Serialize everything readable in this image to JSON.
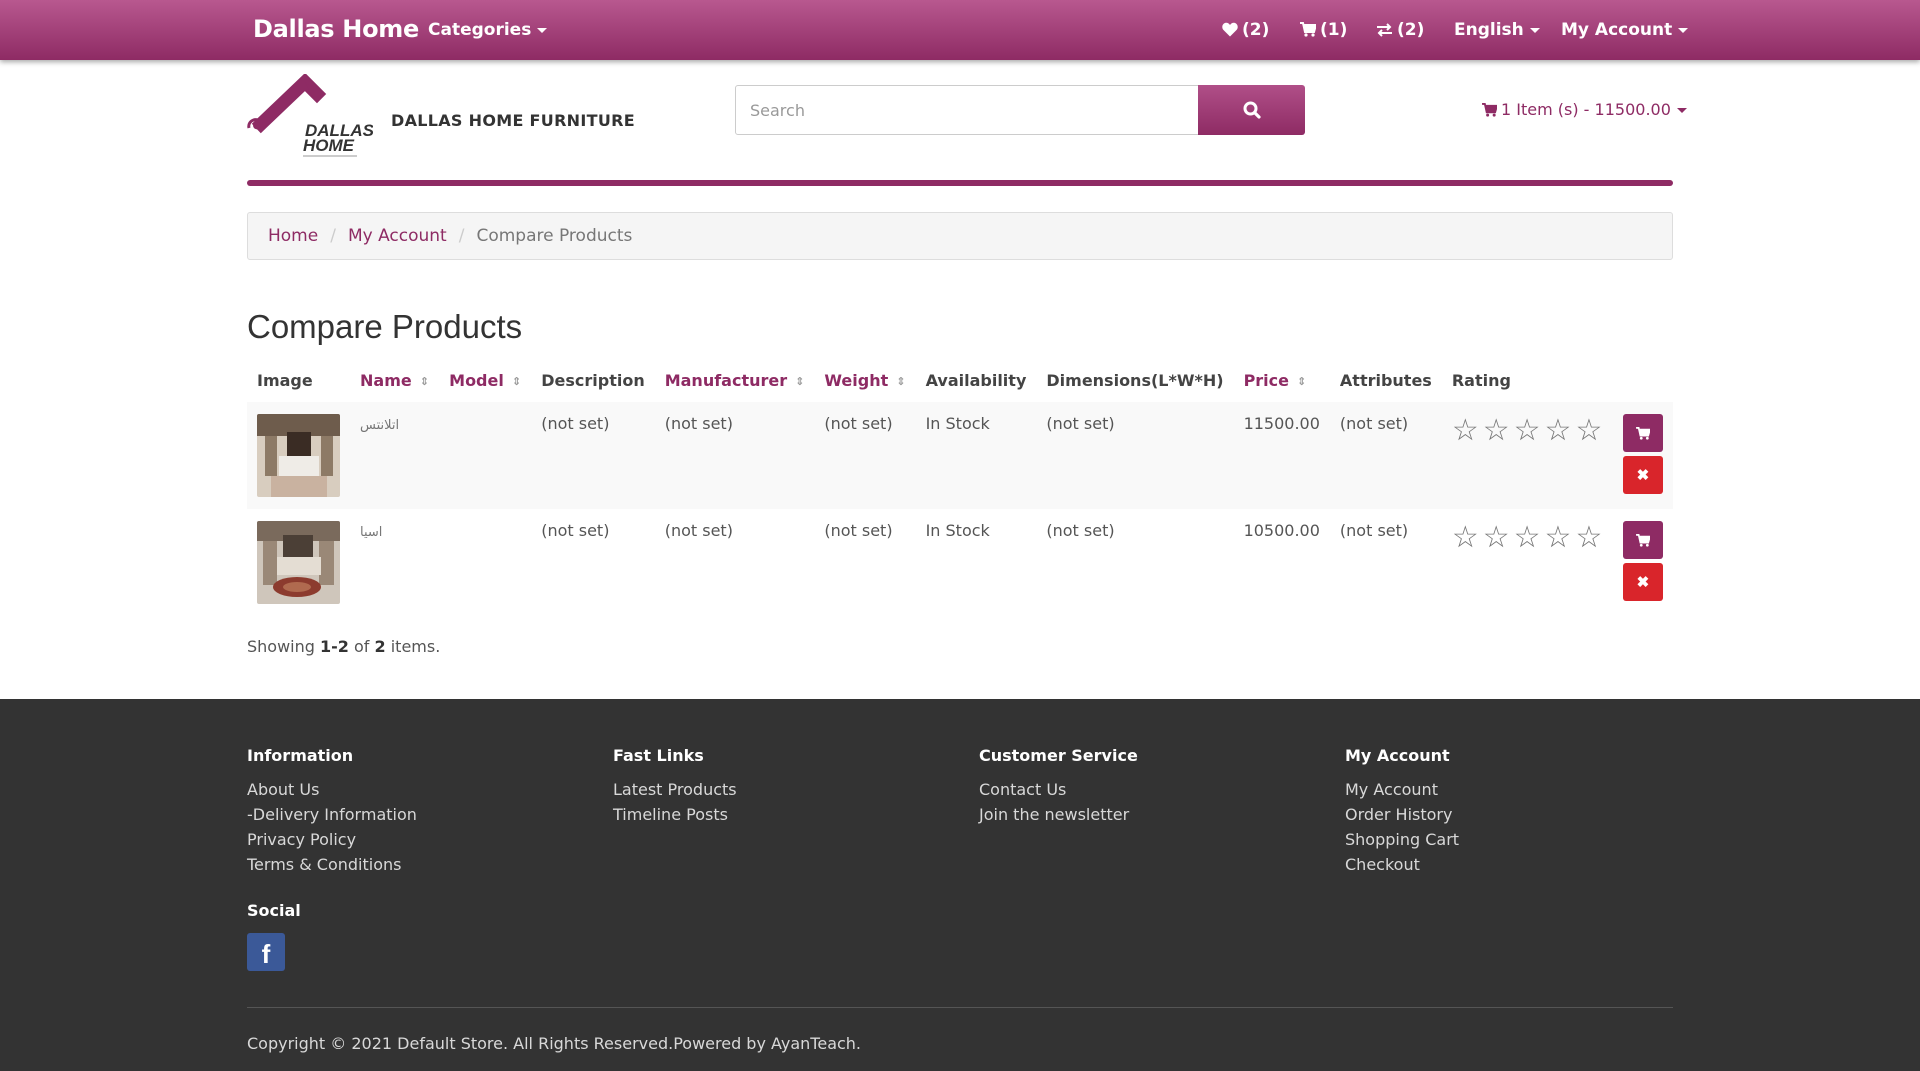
{
  "navbar": {
    "brand": "Dallas Home",
    "categories_label": "Categories",
    "wishlist_label": "(2)",
    "cart_label": "(1)",
    "compare_label": "(2)",
    "language_label": "English",
    "account_label": "My Account"
  },
  "header": {
    "store_name": "DALLAS HOME FURNITURE",
    "search_placeholder": "Search",
    "cart_summary": "1 Item (s) - 11500.00"
  },
  "breadcrumb": {
    "home": "Home",
    "account": "My Account",
    "current": "Compare Products"
  },
  "page": {
    "title": "Compare Products"
  },
  "table": {
    "columns": {
      "image": "Image",
      "name": "Name",
      "model": "Model",
      "description": "Description",
      "manufacturer": "Manufacturer",
      "weight": "Weight",
      "availability": "Availability",
      "dimensions": "Dimensions(L*W*H)",
      "price": "Price",
      "attributes": "Attributes",
      "rating": "Rating"
    },
    "rows": [
      {
        "name": "اتلانتس",
        "model": "",
        "description": "(not set)",
        "manufacturer": "(not set)",
        "weight": "(not set)",
        "availability": "In Stock",
        "dimensions": "(not set)",
        "price": "11500.00",
        "attributes": "(not set)",
        "rating": 0
      },
      {
        "name": "اسيا",
        "model": "",
        "description": "(not set)",
        "manufacturer": "(not set)",
        "weight": "(not set)",
        "availability": "In Stock",
        "dimensions": "(not set)",
        "price": "10500.00",
        "attributes": "(not set)",
        "rating": 0
      }
    ]
  },
  "summary": {
    "prefix": "Showing ",
    "range": "1-2",
    "middle": " of ",
    "total": "2",
    "suffix": " items."
  },
  "footer": {
    "information": {
      "title": "Information",
      "links": [
        "About Us",
        "-Delivery Information",
        "Privacy Policy",
        "Terms & Conditions"
      ]
    },
    "fast_links": {
      "title": "Fast Links",
      "links": [
        "Latest Products",
        "Timeline Posts"
      ]
    },
    "customer_service": {
      "title": "Customer Service",
      "links": [
        "Contact Us",
        "Join the newsletter"
      ]
    },
    "my_account": {
      "title": "My Account",
      "links": [
        "My Account",
        "Order History",
        "Shopping Cart",
        "Checkout"
      ]
    },
    "social_title": "Social",
    "copyright": "Copyright © 2021 Default Store. All Rights Reserved.Powered by AyanTeach."
  },
  "colors": {
    "brand": "#8e2b64",
    "remove": "#d9252b",
    "footer_bg": "#333333",
    "facebook": "#3b5998"
  },
  "icons": [
    "heart-icon",
    "shopping-cart-icon",
    "exchange-icon",
    "search-icon",
    "facebook-icon",
    "star-empty-icon",
    "close-icon"
  ]
}
